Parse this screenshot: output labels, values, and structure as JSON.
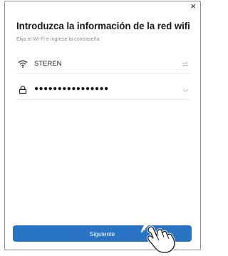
{
  "dialog": {
    "close_glyph": "×",
    "title": "Introduzca la información de la red wifi",
    "subtitle": "Elija el Wi-Fi e ingrese la contraseña"
  },
  "wifi_field": {
    "icon": "wifi-icon",
    "value": "STEREN",
    "switch_icon": "swap-icon"
  },
  "password_field": {
    "icon": "lock-icon",
    "value": "●●●●●●●●●●●●●●●●",
    "toggle_icon": "chevron-down-icon"
  },
  "next_button": {
    "label": "Siguiente",
    "color": "#2a74c4"
  },
  "hint": {
    "icon": "tap-hand-icon"
  }
}
